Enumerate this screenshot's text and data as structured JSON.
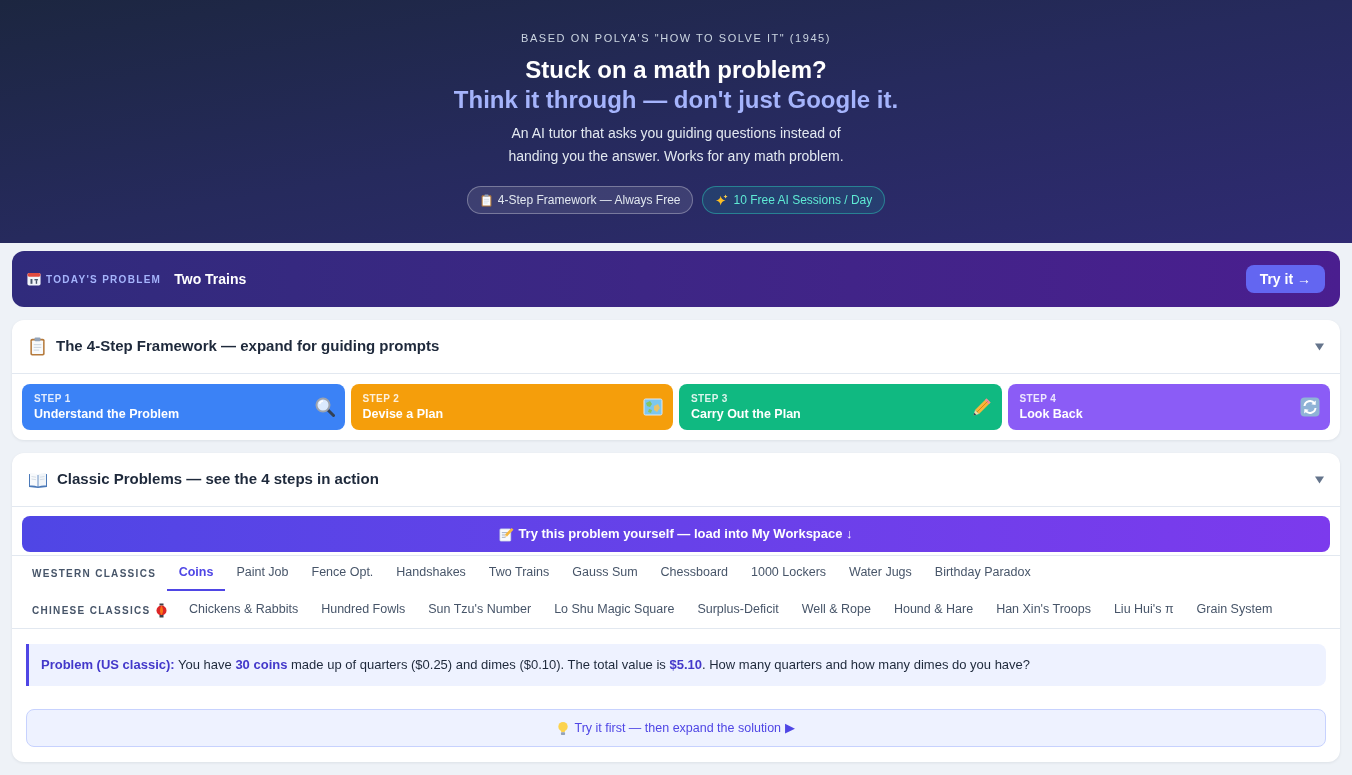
{
  "hero": {
    "eyebrow": "BASED ON POLYA'S \"HOW TO SOLVE IT\" (1945)",
    "title": "Stuck on a math problem?",
    "tagline": "Think it through — don't just Google it.",
    "subtitle": "An AI tutor that asks you guiding questions instead of handing you the answer. Works for any math problem.",
    "badges": [
      {
        "kind": "plain",
        "label": "4-Step Framework — Always Free"
      },
      {
        "kind": "highlight",
        "label": "10 Free AI Sessions / Day"
      }
    ]
  },
  "daily_problem": {
    "label": "TODAY'S PROBLEM",
    "title": "Two Trains",
    "button": "Try it →"
  },
  "framework": {
    "title": "The 4-Step Framework — expand for guiding prompts",
    "steps": [
      {
        "step": "STEP 1",
        "title": "Understand the Problem",
        "color": "#3b82f6"
      },
      {
        "step": "STEP 2",
        "title": "Devise a Plan",
        "color": "#f59e0b"
      },
      {
        "step": "STEP 3",
        "title": "Carry Out the Plan",
        "color": "#10b981"
      },
      {
        "step": "STEP 4",
        "title": "Look Back",
        "color": "#8b5cf6"
      }
    ]
  },
  "classics": {
    "title": "Classic Problems — see the 4 steps in action",
    "cta": "Try this problem yourself — load into My Workspace ↓",
    "groups": [
      {
        "label": "WESTERN CLASSICS",
        "tabs": [
          {
            "label": "Coins",
            "selected": true
          },
          {
            "label": "Paint Job",
            "selected": false
          },
          {
            "label": "Fence Opt.",
            "selected": false
          },
          {
            "label": "Handshakes",
            "selected": false
          },
          {
            "label": "Two Trains",
            "selected": false
          },
          {
            "label": "Gauss Sum",
            "selected": false
          },
          {
            "label": "Chessboard",
            "selected": false
          },
          {
            "label": "1000 Lockers",
            "selected": false
          },
          {
            "label": "Water Jugs",
            "selected": false
          },
          {
            "label": "Birthday Paradox",
            "selected": false
          }
        ]
      },
      {
        "label": "CHINESE CLASSICS",
        "tabs": [
          {
            "label": "Chickens & Rabbits",
            "selected": false
          },
          {
            "label": "Hundred Fowls",
            "selected": false
          },
          {
            "label": "Sun Tzu's Number",
            "selected": false
          },
          {
            "label": "Lo Shu Magic Square",
            "selected": false
          },
          {
            "label": "Surplus-Deficit",
            "selected": false
          },
          {
            "label": "Well & Rope",
            "selected": false
          },
          {
            "label": "Hound & Hare",
            "selected": false
          },
          {
            "label": "Han Xin's Troops",
            "selected": false
          },
          {
            "label": "Liu Hui's π",
            "selected": false
          },
          {
            "label": "Grain System",
            "selected": false
          }
        ]
      }
    ],
    "problem": "**Problem (US classic):** You have **30 coins** made up of quarters ($0.25) and dimes ($0.10). The total value is **$5.10**. How many quarters and how many dimes do you have?",
    "hint_button": "Try it first — then expand the solution ▶"
  }
}
